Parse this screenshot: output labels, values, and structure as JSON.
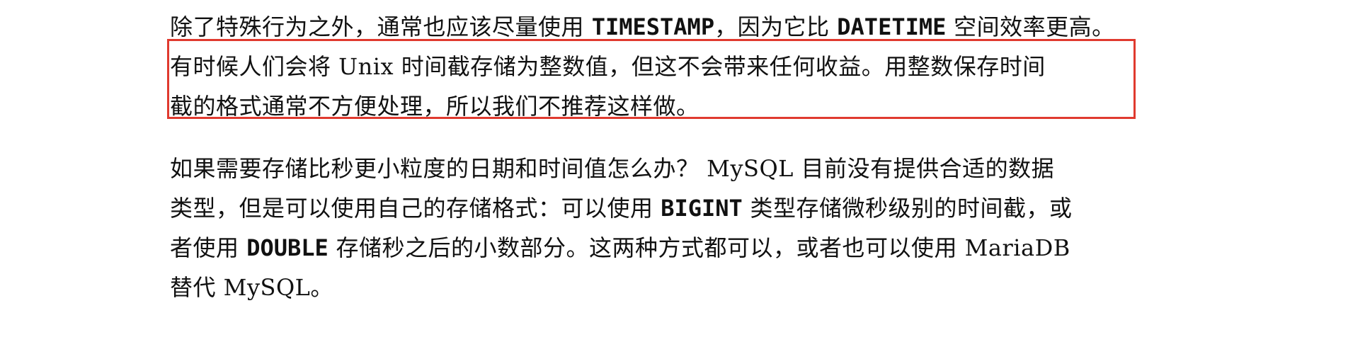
{
  "document": {
    "paragraph1": {
      "line1": {
        "a": "除了特殊行为之外，通常也应该尽量使用 ",
        "code1": "TIMESTAMP",
        "b": "，因为它比 ",
        "code2": "DATETIME",
        "c": " 空间效率更高。"
      },
      "line2": "有时候人们会将 Unix 时间截存储为整数值，但这不会带来任何收益。用整数保存时间",
      "line3": "截的格式通常不方便处理，所以我们不推荐这样做。"
    },
    "paragraph2": {
      "line1": "如果需要存储比秒更小粒度的日期和时间值怎么办？ MySQL 目前没有提供合适的数据",
      "line2": {
        "a": "类型，但是可以使用自己的存储格式：可以使用 ",
        "code": "BIGINT",
        "b": " 类型存储微秒级别的时间截，或"
      },
      "line3": {
        "a": "者使用 ",
        "code": "DOUBLE",
        "b": " 存储秒之后的小数部分。这两种方式都可以，或者也可以使用 MariaDB"
      },
      "line4": "替代 MySQL。"
    }
  },
  "colors": {
    "text": "#111111",
    "highlight_border": "#e03a2f"
  }
}
